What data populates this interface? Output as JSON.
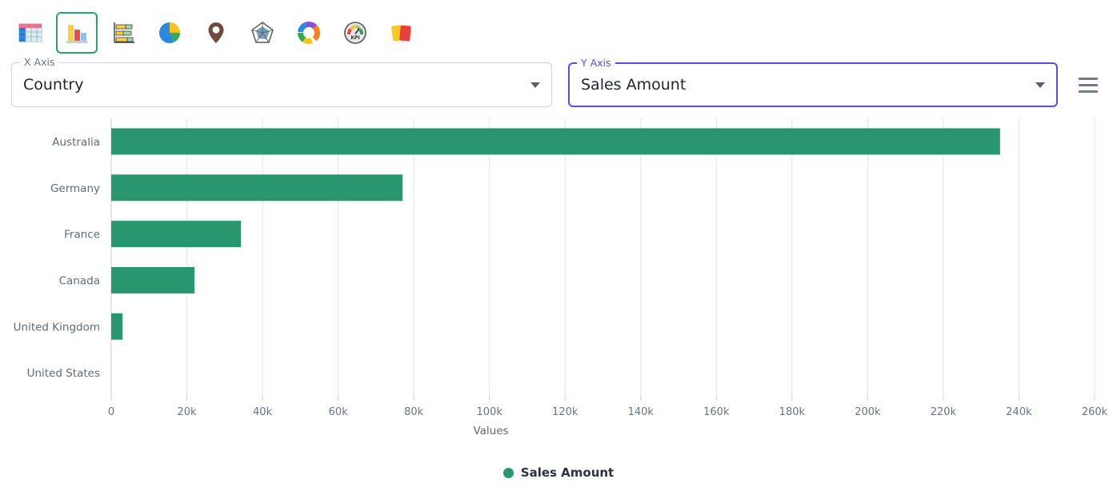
{
  "toolbar": {
    "items": [
      {
        "name": "table-chart",
        "label": "Table",
        "selected": false
      },
      {
        "name": "column-chart",
        "label": "Column Chart",
        "selected": true
      },
      {
        "name": "bar-chart",
        "label": "Bar Chart",
        "selected": false
      },
      {
        "name": "pie-chart",
        "label": "Pie Chart",
        "selected": false
      },
      {
        "name": "map-chart",
        "label": "Map",
        "selected": false
      },
      {
        "name": "radar-chart",
        "label": "Radar Chart",
        "selected": false
      },
      {
        "name": "donut-chart",
        "label": "Donut Chart",
        "selected": false
      },
      {
        "name": "kpi-gauge",
        "label": "KPI",
        "selected": false
      },
      {
        "name": "card-chart",
        "label": "Cards",
        "selected": false
      }
    ]
  },
  "controls": {
    "x_axis": {
      "label": "X Axis",
      "value": "Country"
    },
    "y_axis": {
      "label": "Y Axis",
      "value": "Sales Amount"
    },
    "menu_label": "Menu"
  },
  "colors": {
    "series": "#2a9670",
    "focus": "#5b4ae8",
    "axis_text": "#6b7280",
    "grid": "#dfe3ec"
  },
  "chart_data": {
    "type": "bar",
    "orientation": "horizontal",
    "title": "",
    "xlabel": "Values",
    "ylabel": "",
    "categories": [
      "Australia",
      "Germany",
      "France",
      "Canada",
      "United Kingdom",
      "United States"
    ],
    "series": [
      {
        "name": "Sales Amount",
        "color": "#2a9670",
        "values": [
          235000,
          77000,
          34300,
          22000,
          3000,
          0
        ]
      }
    ],
    "xlim": [
      0,
      260000
    ],
    "xticks": [
      0,
      20000,
      40000,
      60000,
      80000,
      100000,
      120000,
      140000,
      160000,
      180000,
      200000,
      220000,
      240000,
      260000
    ],
    "xtick_labels": [
      "0",
      "20k",
      "40k",
      "60k",
      "80k",
      "100k",
      "120k",
      "140k",
      "160k",
      "180k",
      "200k",
      "220k",
      "240k",
      "260k"
    ],
    "grid": true,
    "legend": {
      "position": "bottom",
      "entries": [
        "Sales Amount"
      ]
    }
  }
}
